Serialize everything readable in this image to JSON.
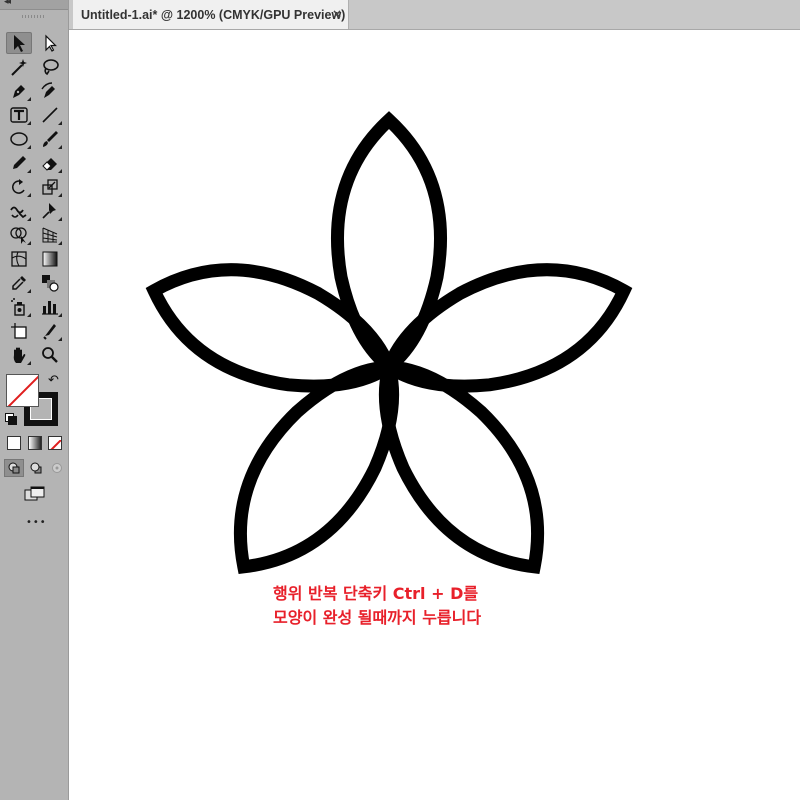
{
  "document_tab": {
    "title": "Untitled-1.ai* @ 1200% (CMYK/GPU Preview)",
    "close_symbol": "×"
  },
  "toolbar": {
    "more_tools_symbol": "•••",
    "tools": [
      {
        "name": "selection-tool",
        "icon": "arrow-icon",
        "active": true
      },
      {
        "name": "direct-selection-tool",
        "icon": "hollow-arrow-icon"
      },
      {
        "name": "magic-wand-tool",
        "icon": "magic-wand-icon"
      },
      {
        "name": "lasso-tool",
        "icon": "lasso-icon"
      },
      {
        "name": "pen-tool",
        "icon": "pen-icon"
      },
      {
        "name": "curvature-tool",
        "icon": "curvature-pen-icon"
      },
      {
        "name": "type-tool",
        "icon": "type-icon"
      },
      {
        "name": "line-segment-tool",
        "icon": "line-icon"
      },
      {
        "name": "ellipse-tool",
        "icon": "ellipse-icon"
      },
      {
        "name": "paintbrush-tool",
        "icon": "brush-icon"
      },
      {
        "name": "pencil-tool",
        "icon": "pencil-icon"
      },
      {
        "name": "eraser-tool",
        "icon": "eraser-icon"
      },
      {
        "name": "rotate-tool",
        "icon": "rotate-icon"
      },
      {
        "name": "scale-tool",
        "icon": "scale-icon"
      },
      {
        "name": "warp-tool",
        "icon": "warp-icon"
      },
      {
        "name": "puppet-warp-tool",
        "icon": "pushpin-icon"
      },
      {
        "name": "shape-builder-tool",
        "icon": "shape-builder-icon"
      },
      {
        "name": "perspective-grid-tool",
        "icon": "perspective-grid-icon"
      },
      {
        "name": "mesh-tool",
        "icon": "mesh-icon"
      },
      {
        "name": "gradient-tool",
        "icon": "gradient-icon"
      },
      {
        "name": "eyedropper-tool",
        "icon": "eyedropper-icon"
      },
      {
        "name": "blend-tool",
        "icon": "blend-icon"
      },
      {
        "name": "symbol-sprayer-tool",
        "icon": "symbol-sprayer-icon"
      },
      {
        "name": "column-graph-tool",
        "icon": "bar-graph-icon"
      },
      {
        "name": "artboard-tool",
        "icon": "artboard-icon"
      },
      {
        "name": "slice-tool",
        "icon": "slice-knife-icon"
      },
      {
        "name": "hand-tool",
        "icon": "hand-icon"
      },
      {
        "name": "zoom-tool",
        "icon": "magnifier-icon"
      }
    ],
    "fill_color": "none",
    "stroke_color": "#000000"
  },
  "canvas": {
    "artwork": "flower-of-five-petals",
    "stroke_color": "#000000",
    "background": "#ffffff",
    "caption": {
      "color": "#e8202a",
      "line1": "행위 반복 단축키 Ctrl + D를",
      "line2": "모양이 완성 될때까지 누릅니다"
    }
  }
}
